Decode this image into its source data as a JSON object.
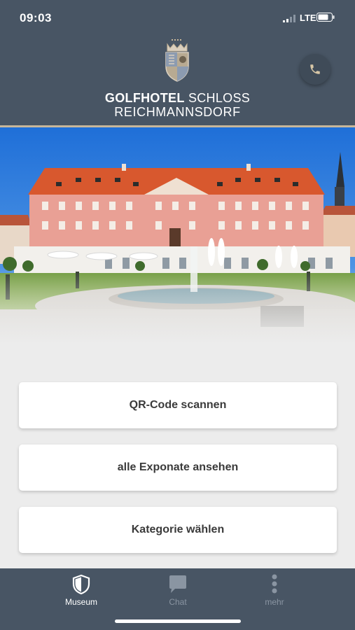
{
  "status_bar": {
    "time": "09:03",
    "network": "LTE"
  },
  "brand": {
    "name_bold": "GOLFHOTEL",
    "name_light": "SCHLOSS",
    "line2": "REICHMANNSDORF"
  },
  "actions": [
    {
      "label": "QR-Code scannen"
    },
    {
      "label": "alle Exponate ansehen"
    },
    {
      "label": "Kategorie wählen"
    }
  ],
  "tabs": [
    {
      "label": "Museum",
      "icon": "shield-icon",
      "active": true
    },
    {
      "label": "Chat",
      "icon": "chat-bubble-icon",
      "active": false
    },
    {
      "label": "mehr",
      "icon": "more-dots-icon",
      "active": false
    }
  ],
  "colors": {
    "header": "#485564",
    "accent_line": "#c8b79a",
    "background": "#ececec",
    "tab_inactive": "#8a95a2"
  }
}
